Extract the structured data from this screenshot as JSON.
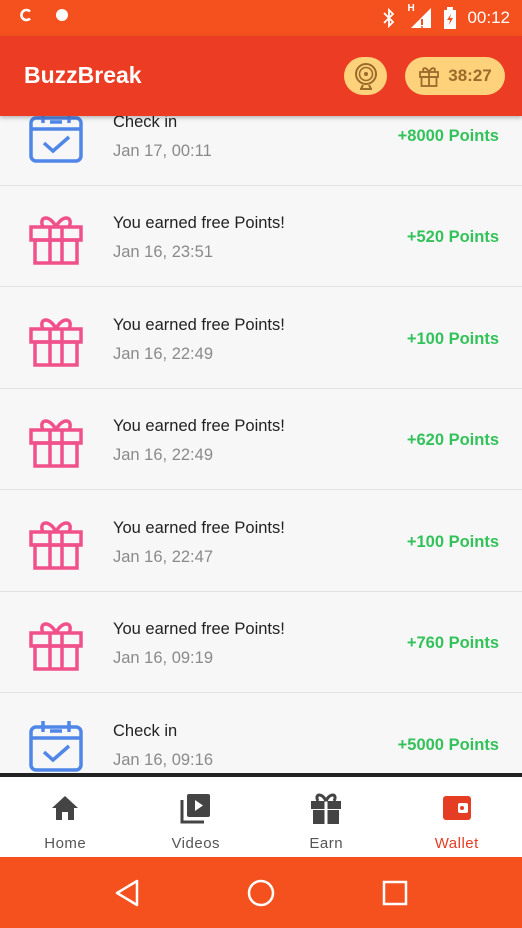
{
  "status_bar": {
    "time": "00:12",
    "network_label": "H"
  },
  "app_bar": {
    "title": "BuzzBreak",
    "timer": "38:27"
  },
  "transactions": [
    {
      "type": "checkin",
      "title": "Check in",
      "time": "Jan 17, 00:11",
      "points": "+8000 Points"
    },
    {
      "type": "gift",
      "title": "You earned free Points!",
      "time": "Jan 16, 23:51",
      "points": "+520 Points"
    },
    {
      "type": "gift",
      "title": "You earned free Points!",
      "time": "Jan 16, 22:49",
      "points": "+100 Points"
    },
    {
      "type": "gift",
      "title": "You earned free Points!",
      "time": "Jan 16, 22:49",
      "points": "+620 Points"
    },
    {
      "type": "gift",
      "title": "You earned free Points!",
      "time": "Jan 16, 22:47",
      "points": "+100 Points"
    },
    {
      "type": "gift",
      "title": "You earned free Points!",
      "time": "Jan 16, 09:19",
      "points": "+760 Points"
    },
    {
      "type": "checkin",
      "title": "Check in",
      "time": "Jan 16, 09:16",
      "points": "+5000 Points"
    }
  ],
  "bottom_nav": [
    {
      "label": "Home",
      "icon": "home-icon",
      "active": false
    },
    {
      "label": "Videos",
      "icon": "videos-icon",
      "active": false
    },
    {
      "label": "Earn",
      "icon": "gift-icon",
      "active": false
    },
    {
      "label": "Wallet",
      "icon": "wallet-icon",
      "active": true
    }
  ],
  "colors": {
    "status_bar": "#f4511e",
    "app_bar": "#ec3d24",
    "points_green": "#33c25a",
    "gift_pink": "#f0518a",
    "checkin_blue": "#4f86e8",
    "active_nav": "#e53c24"
  }
}
